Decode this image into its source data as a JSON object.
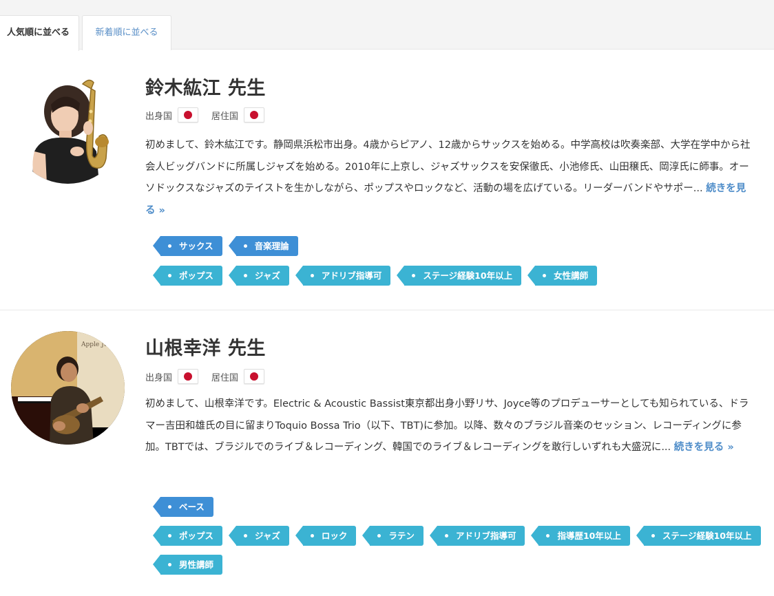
{
  "tabs": {
    "popular": "人気順に並べる",
    "newest": "新着順に並べる"
  },
  "labels": {
    "origin": "出身国",
    "residence": "居住国",
    "more": "続きを見る »"
  },
  "colors": {
    "instrument_tag": "#3e8fd6",
    "genre_tag": "#3bb3d3",
    "link": "#4f8dc9",
    "flag_red": "#c8102e"
  },
  "teachers": [
    {
      "name": "鈴木紘江 先生",
      "origin_flag": "japan-flag-icon",
      "residence_flag": "japan-flag-icon",
      "bio": "初めまして、鈴木紘江です。静岡県浜松市出身。4歳からピアノ、12歳からサックスを始める。中学高校は吹奏楽部、大学在学中から社会人ビッグバンドに所属しジャズを始める。2010年に上京し、ジャズサックスを安保徹氏、小池修氏、山田穣氏、岡淳氏に師事。オーソドックスなジャズのテイストを生かしながら、ポップスやロックなど、活動の場を広げている。リーダーバンドやサポー...",
      "instrument_tags": [
        "サックス",
        "音楽理論"
      ],
      "genre_tags": [
        "ポップス",
        "ジャズ",
        "アドリブ指導可",
        "ステージ経験10年以上",
        "女性講師"
      ]
    },
    {
      "name": "山根幸洋 先生",
      "origin_flag": "japan-flag-icon",
      "residence_flag": "japan-flag-icon",
      "bio": "初めまして、山根幸洋です。Electric & Acoustic Bassist東京都出身小野リサ、Joyce等のプロデューサーとしても知られている、ドラマー吉田和雄氏の目に留まりToquio Bossa Trio（以下、TBT)に参加。以降、数々のブラジル音楽のセッション、レコーディングに参加。TBTでは、ブラジルでのライブ＆レコーディング、韓国でのライブ＆レコーディングを敢行しいずれも大盛況に...",
      "instrument_tags": [
        "ベース"
      ],
      "genre_tags": [
        "ポップス",
        "ジャズ",
        "ロック",
        "ラテン",
        "アドリブ指導可",
        "指導歴10年以上",
        "ステージ経験10年以上"
      ],
      "genre_tags_2": [
        "男性講師"
      ]
    }
  ]
}
